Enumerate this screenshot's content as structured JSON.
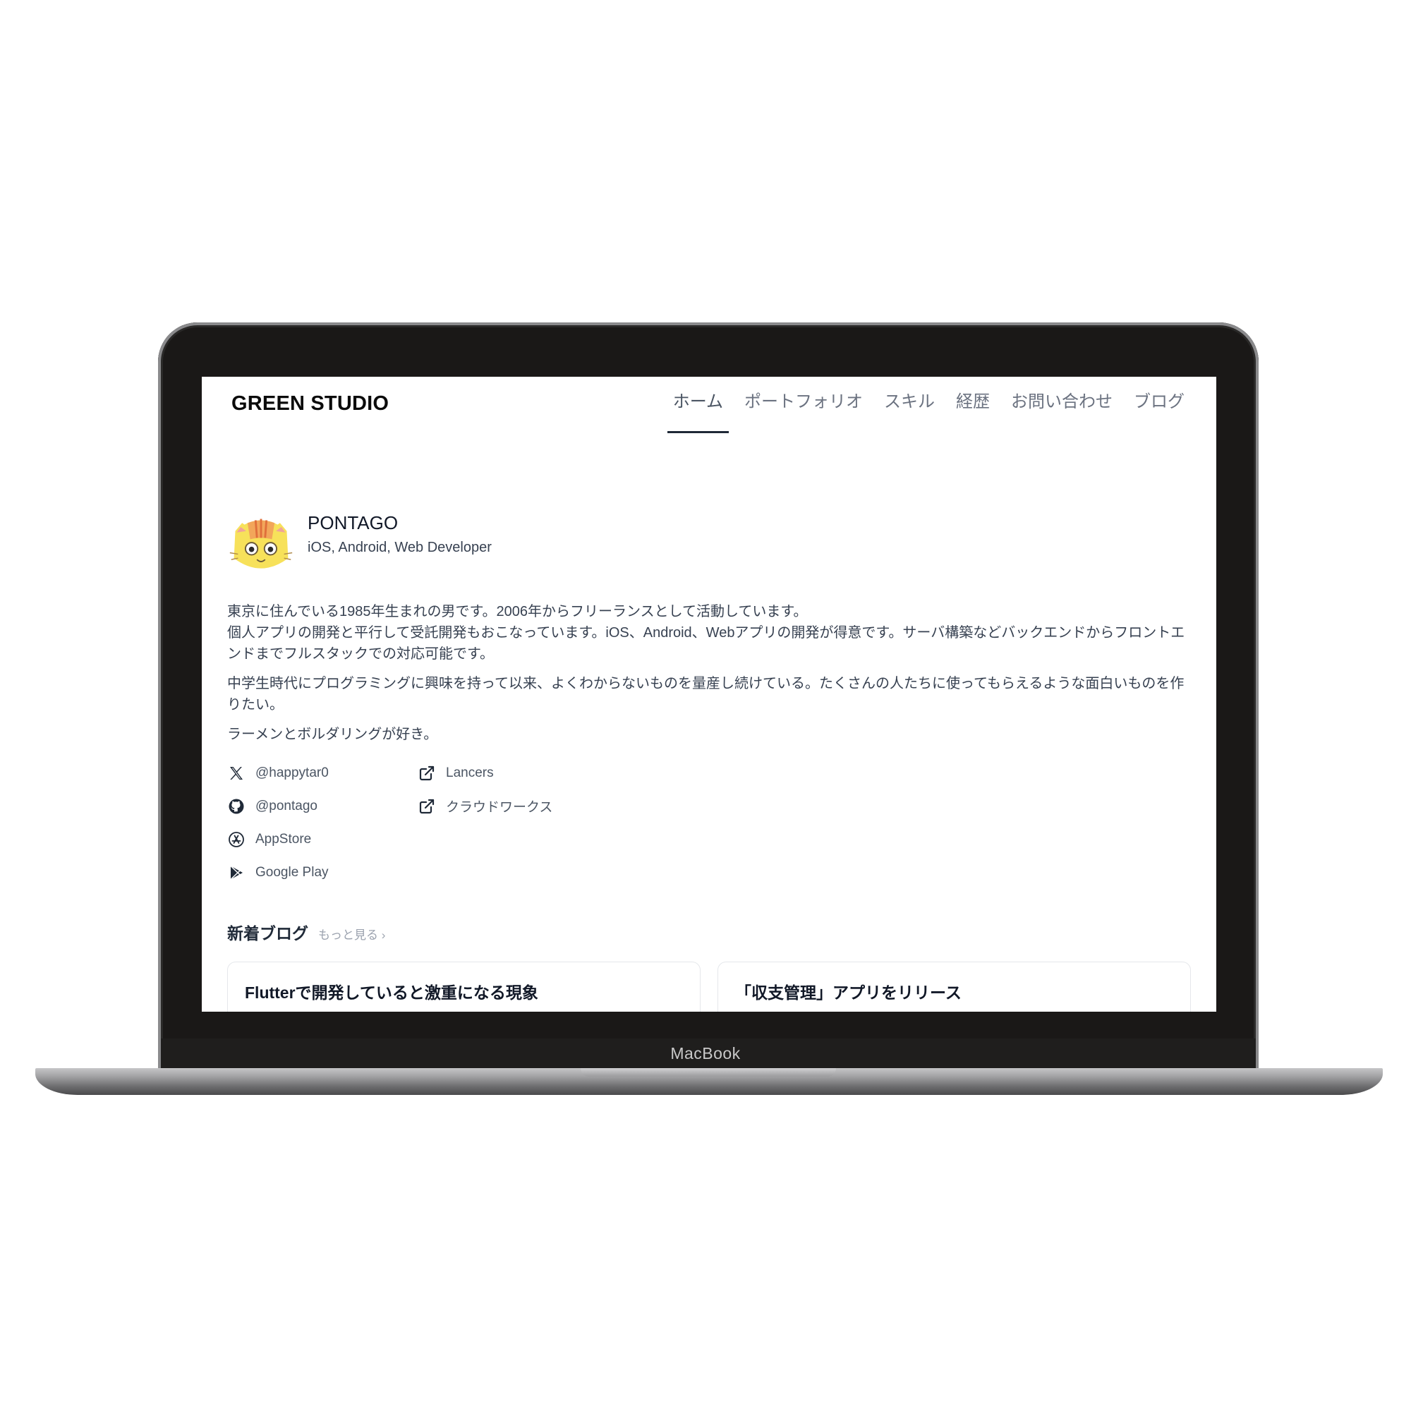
{
  "device": {
    "brand": "MacBook"
  },
  "site": {
    "logo": "GREEN STUDIO",
    "nav": [
      {
        "label": "ホーム",
        "active": true
      },
      {
        "label": "ポートフォリオ"
      },
      {
        "label": "スキル"
      },
      {
        "label": "経歴"
      },
      {
        "label": "お問い合わせ"
      },
      {
        "label": "ブログ"
      }
    ]
  },
  "profile": {
    "name": "PONTAGO",
    "role": "iOS, Android, Web Developer",
    "avatar_icon": "cat-face-icon"
  },
  "bio": {
    "p1_line1": "東京に住んでいる1985年生まれの男です。2006年からフリーランスとして活動しています。",
    "p1_line2": "個人アプリの開発と平行して受託開発もおこなっています。iOS、Android、Webアプリの開発が得意です。サーバ構築などバックエンドからフロントエンドまでフルスタックでの対応可能です。",
    "p2": "中学生時代にプログラミングに興味を持って以来、よくわからないものを量産し続けている。たくさんの人たちに使ってもらえるような面白いものを作りたい。",
    "p3": "ラーメンとボルダリングが好き。"
  },
  "links": {
    "x": {
      "label": "@happytar0",
      "icon": "x-logo-icon"
    },
    "lancers": {
      "label": "Lancers",
      "icon": "external-link-icon"
    },
    "github": {
      "label": "@pontago",
      "icon": "github-icon"
    },
    "crowdworks": {
      "label": "クラウドワークス",
      "icon": "external-link-icon"
    },
    "appstore": {
      "label": "AppStore",
      "icon": "appstore-icon"
    },
    "googleplay": {
      "label": "Google Play",
      "icon": "google-play-icon"
    }
  },
  "blog": {
    "title": "新着ブログ",
    "more": "もっと見る",
    "posts": [
      {
        "title": "Flutterで開発していると激重になる現象"
      },
      {
        "title": "「収支管理」アプリをリリース"
      }
    ]
  }
}
